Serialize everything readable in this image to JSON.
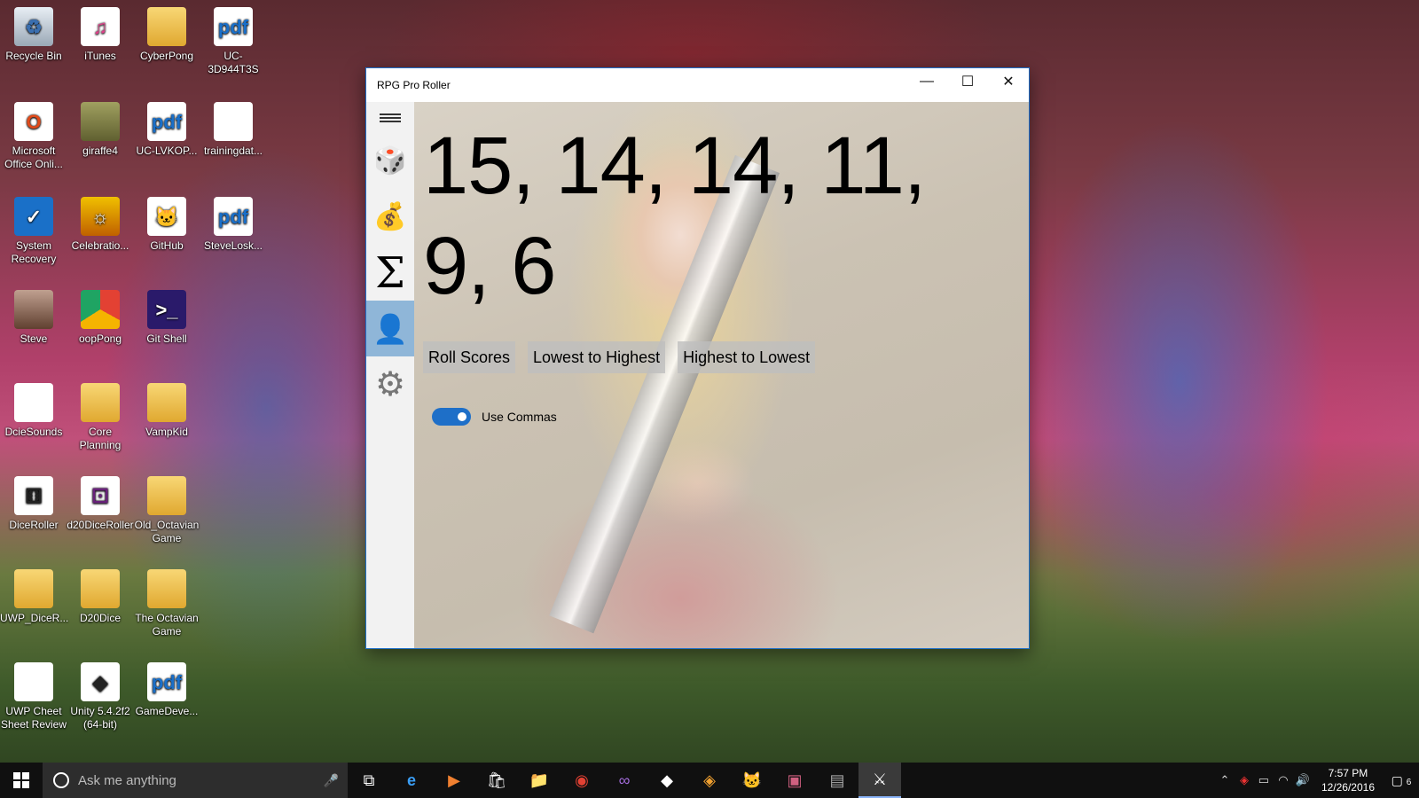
{
  "desktop": {
    "icons": [
      {
        "label": "Recycle Bin",
        "glyph": "♻"
      },
      {
        "label": "iTunes",
        "glyph": "♫"
      },
      {
        "label": "CyberPong",
        "glyph": ""
      },
      {
        "label": "UC-3D944T3S",
        "glyph": "pdf"
      },
      {
        "label": "Microsoft Office Onli...",
        "glyph": "O"
      },
      {
        "label": "giraffe4",
        "glyph": ""
      },
      {
        "label": "UC-LVKOP...",
        "glyph": "pdf"
      },
      {
        "label": "trainingdat...",
        "glyph": ""
      },
      {
        "label": "System Recovery",
        "glyph": "✓"
      },
      {
        "label": "Celebratio...",
        "glyph": "☼"
      },
      {
        "label": "GitHub",
        "glyph": "🐱"
      },
      {
        "label": "SteveLosk...",
        "glyph": "pdf"
      },
      {
        "label": "Steve",
        "glyph": ""
      },
      {
        "label": "oopPong",
        "glyph": ""
      },
      {
        "label": "Git Shell",
        "glyph": ">_"
      },
      {
        "label": "DcieSounds",
        "glyph": ""
      },
      {
        "label": "Core Planning",
        "glyph": ""
      },
      {
        "label": "VampKid",
        "glyph": ""
      },
      {
        "label": "DiceRoller",
        "glyph": "⚅"
      },
      {
        "label": "d20DiceRoller",
        "glyph": "⚀"
      },
      {
        "label": "Old_Octavian Game",
        "glyph": ""
      },
      {
        "label": "UWP_DiceR...",
        "glyph": ""
      },
      {
        "label": "D20Dice",
        "glyph": ""
      },
      {
        "label": "The Octavian Game",
        "glyph": ""
      },
      {
        "label": "UWP Cheet Sheet Review",
        "glyph": ""
      },
      {
        "label": "Unity 5.4.2f2 (64-bit)",
        "glyph": "◆"
      },
      {
        "label": "GameDeve...",
        "glyph": "pdf"
      }
    ]
  },
  "window": {
    "title": "RPG Pro Roller",
    "minimize_glyph": "—",
    "maximize_glyph": "☐",
    "close_glyph": "✕"
  },
  "nav": {
    "dice_glyph": "🎲",
    "bag_glyph": "💰",
    "sum_glyph": "Σ",
    "character_glyph": "👤",
    "settings_glyph": "⚙"
  },
  "main": {
    "scores_text": "15, 14, 14, 11, 9, 6",
    "buttons": [
      "Roll Scores",
      "Lowest to Highest",
      "Highest to Lowest"
    ],
    "toggle_label": "Use Commas",
    "toggle_on": true
  },
  "taskbar": {
    "search_placeholder": "Ask me anything",
    "mic_glyph": "🎤",
    "apps": [
      {
        "name": "task-view",
        "glyph": "⧉"
      },
      {
        "name": "edge",
        "glyph": "e"
      },
      {
        "name": "media",
        "glyph": "▶"
      },
      {
        "name": "store",
        "glyph": "🛍"
      },
      {
        "name": "file-explorer",
        "glyph": "📁"
      },
      {
        "name": "chrome",
        "glyph": "◉"
      },
      {
        "name": "visual-studio",
        "glyph": "∞"
      },
      {
        "name": "unity",
        "glyph": "◆"
      },
      {
        "name": "git",
        "glyph": "◈"
      },
      {
        "name": "github",
        "glyph": "🐱"
      },
      {
        "name": "app-1",
        "glyph": "▣"
      },
      {
        "name": "app-2",
        "glyph": "▤"
      },
      {
        "name": "rpg-pro-roller",
        "glyph": "⚔"
      }
    ],
    "time": "7:57 PM",
    "date": "12/26/2016",
    "notification_count": "6"
  }
}
